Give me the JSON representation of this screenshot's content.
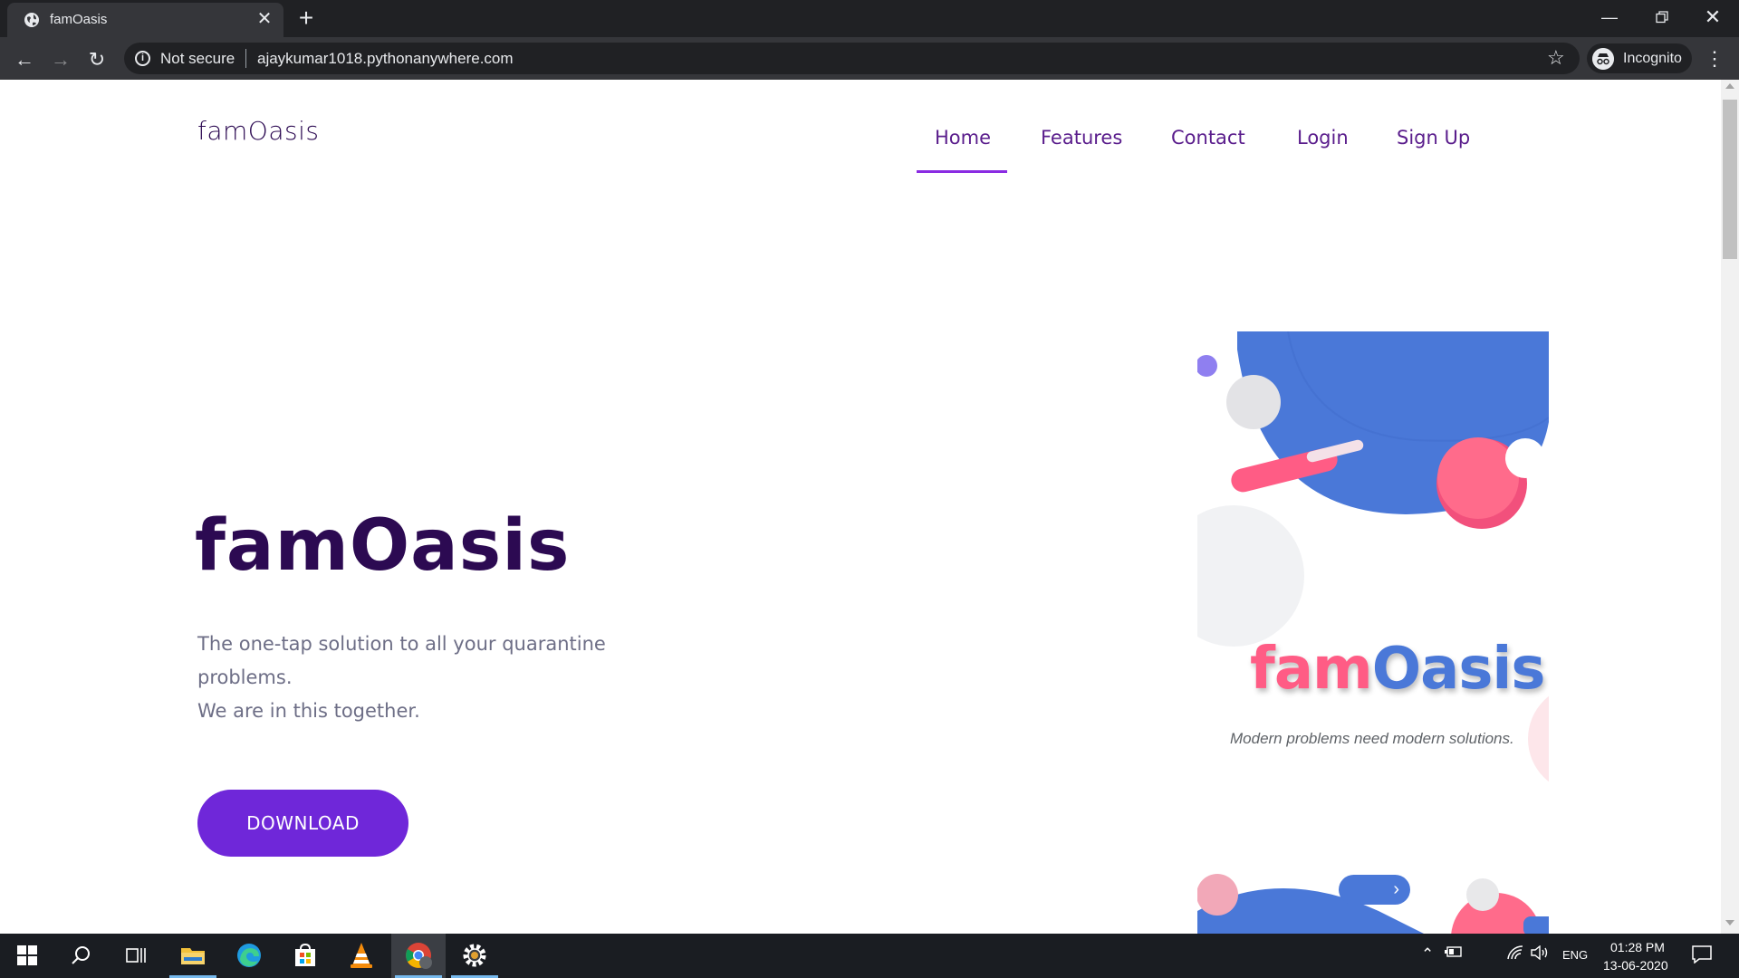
{
  "browser": {
    "tab_title": "famOasis",
    "not_secure_label": "Not secure",
    "url": "ajaykumar1018.pythonanywhere.com",
    "incognito_label": "Incognito"
  },
  "site": {
    "brand": "famOasis",
    "nav": {
      "home": "Home",
      "features": "Features",
      "contact": "Contact",
      "login": "Login",
      "signup": "Sign Up"
    },
    "hero": {
      "title": "famOasis",
      "line1": "The one-tap solution to all your quarantine problems.",
      "line2": "We are in this together.",
      "download_label": "DOWNLOAD"
    },
    "art": {
      "word_fam": "fam",
      "word_oasis": "Oasis",
      "tagline": "Modern problems need modern solutions."
    }
  },
  "taskbar": {
    "language": "ENG",
    "time": "01:28 PM",
    "date": "13-06-2020"
  },
  "colors": {
    "brand_dark": "#2c0a52",
    "accent_purple": "#6f27d9",
    "art_blue": "#4a78d8",
    "art_pink": "#ff5c85"
  }
}
